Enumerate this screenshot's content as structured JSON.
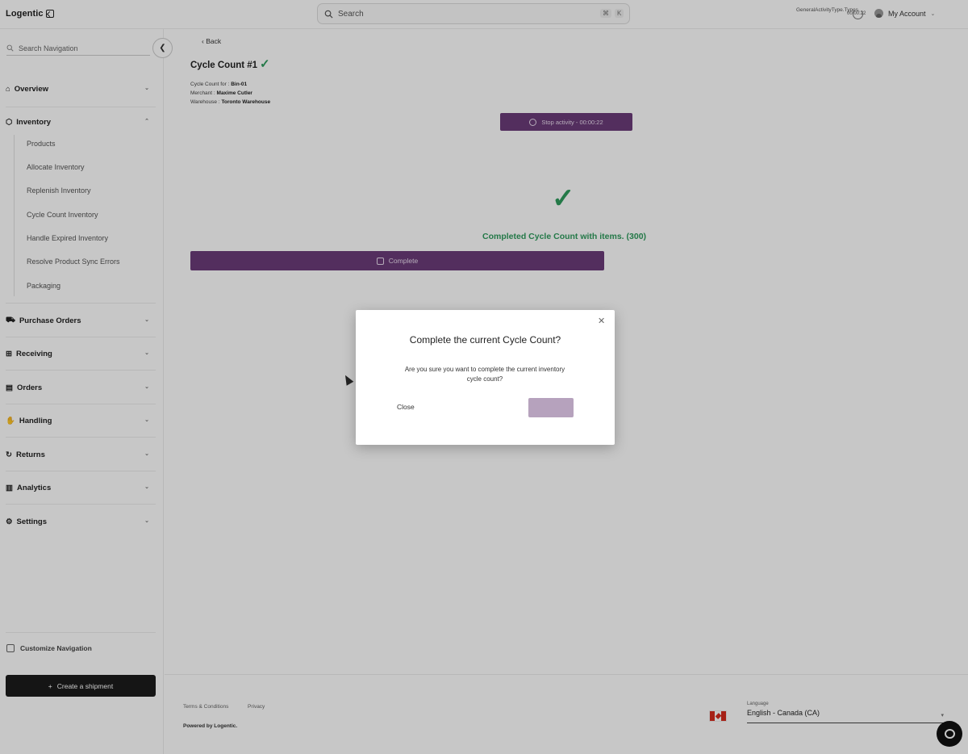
{
  "app": {
    "logo_text": "Logentic"
  },
  "header": {
    "search_placeholder": "Search",
    "shortcut_cmd": "⌘",
    "shortcut_key": "K",
    "activity_text": "GeneralActivityType.Types.",
    "timer_text": "00:00:22",
    "account_label": "My Account"
  },
  "sidebar": {
    "search_placeholder": "Search Navigation",
    "sections": {
      "overview": "Overview",
      "inventory": "Inventory",
      "purchase_orders": "Purchase Orders",
      "receiving": "Receiving",
      "orders": "Orders",
      "handling": "Handling",
      "returns": "Returns",
      "analytics": "Analytics",
      "settings": "Settings"
    },
    "inventory_items": [
      "Products",
      "Allocate Inventory",
      "Replenish Inventory",
      "Cycle Count Inventory",
      "Handle Expired Inventory",
      "Resolve Product Sync Errors",
      "Packaging"
    ],
    "customize_label": "Customize Navigation",
    "create_shipment_label": "Create a shipment"
  },
  "main": {
    "back_label": "Back",
    "title": "Cycle Count #1",
    "meta": {
      "cycle_for_label": "Cycle Count for :",
      "cycle_for_value": "Bin-01",
      "merchant_label": "Merchant :",
      "merchant_value": "Maxime Cutler",
      "warehouse_label": "Warehouse :",
      "warehouse_value": "Toronto Warehouse"
    },
    "stop_activity_label": "Stop activity - 00:00:22",
    "completed_message": "Completed Cycle Count with items. (300)",
    "complete_button_label": "Complete"
  },
  "footer": {
    "terms": "Terms & Conditions",
    "privacy": "Privacy",
    "powered_by": "Powered by Logentic.",
    "language_label": "Language",
    "language_value": "English - Canada (CA)"
  },
  "modal": {
    "title": "Complete the current Cycle Count?",
    "body": "Are you sure you want to complete the current inventory cycle count?",
    "close_label": "Close",
    "confirm_label": ""
  },
  "colors": {
    "accent_purple": "#6b3b79",
    "success_green": "#2f9b5d",
    "confirm_disabled": "#b6a2bd"
  }
}
